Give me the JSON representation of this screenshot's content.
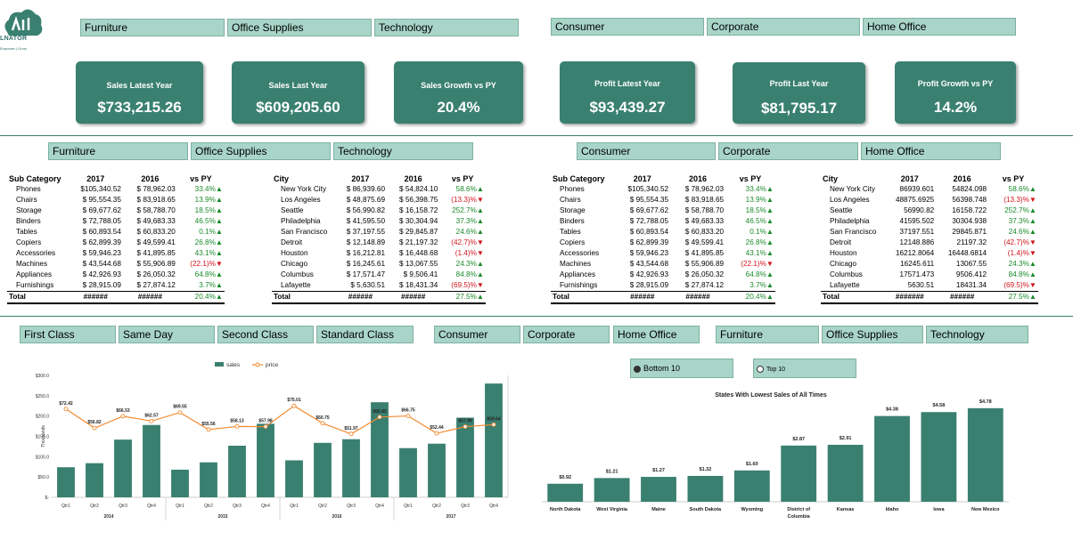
{
  "logo": {
    "text": "LNATOR",
    "tagline": "Empower | Grow",
    "colors": {
      "teal": "#3a8070",
      "light": "#a8d5c8"
    }
  },
  "top_slicers": {
    "category": [
      "Furniture",
      "Office Supplies",
      "Technology"
    ],
    "segment": [
      "Consumer",
      "Corporate",
      "Home Office"
    ]
  },
  "kpis": [
    {
      "title": "Sales Latest Year",
      "value": "$733,215.26"
    },
    {
      "title": "Sales Last Year",
      "value": "$609,205.60"
    },
    {
      "title": "Sales Growth vs PY",
      "value": "20.4%"
    },
    {
      "title": "Profit Latest Year",
      "value": "$93,439.27"
    },
    {
      "title": "Profit Last Year",
      "value": "$81,795.17"
    },
    {
      "title": "Profit Growth vs PY",
      "value": "14.2%"
    }
  ],
  "mid_slicers": {
    "category": [
      "Furniture",
      "Office Supplies",
      "Technology"
    ],
    "segment": [
      "Consumer",
      "Corporate",
      "Home Office"
    ]
  },
  "table1": {
    "headers": [
      "Sub Category",
      "2017",
      "2016",
      "vs PY"
    ],
    "rows": [
      [
        "Phones",
        "$105,340.52",
        "$ 78,962.03",
        "33.4%▲"
      ],
      [
        "Chairs",
        "$ 95,554.35",
        "$ 83,918.65",
        "13.9%▲"
      ],
      [
        "Storage",
        "$ 69,677.62",
        "$ 58,788.70",
        "18.5%▲"
      ],
      [
        "Binders",
        "$ 72,788.05",
        "$ 49,683.33",
        "46.5%▲"
      ],
      [
        "Tables",
        "$ 60,893.54",
        "$ 60,833.20",
        "0.1%▲"
      ],
      [
        "Copiers",
        "$ 62,899.39",
        "$ 49,599.41",
        "26.8%▲"
      ],
      [
        "Accessories",
        "$ 59,946.23",
        "$ 41,895.85",
        "43.1%▲"
      ],
      [
        "Machines",
        "$ 43,544.68",
        "$ 55,906.89",
        "(22.1)%▼"
      ],
      [
        "Appliances",
        "$ 42,926.93",
        "$ 26,050.32",
        "64.8%▲"
      ],
      [
        "Furnishings",
        "$ 28,915.09",
        "$ 27,874.12",
        "3.7%▲"
      ]
    ],
    "total": [
      "Total",
      "######",
      "######",
      "20.4%▲"
    ]
  },
  "table2": {
    "headers": [
      "City",
      "2017",
      "2016",
      "vs PY"
    ],
    "rows": [
      [
        "New York City",
        "$ 86,939.60",
        "$ 54,824.10",
        "58.6%▲"
      ],
      [
        "Los Angeles",
        "$ 48,875.69",
        "$ 56,398.75",
        "(13.3)%▼"
      ],
      [
        "Seattle",
        "$ 56,990.82",
        "$ 16,158.72",
        "252.7%▲"
      ],
      [
        "Philadelphia",
        "$ 41,595.50",
        "$ 30,304.94",
        "37.3%▲"
      ],
      [
        "San Francisco",
        "$ 37,197.55",
        "$ 29,845.87",
        "24.6%▲"
      ],
      [
        "Detroit",
        "$ 12,148.89",
        "$ 21,197.32",
        "(42.7)%▼"
      ],
      [
        "Houston",
        "$ 16,212.81",
        "$ 16,448.68",
        "(1.4)%▼"
      ],
      [
        "Chicago",
        "$ 16,245.61",
        "$ 13,067.55",
        "24.3%▲"
      ],
      [
        "Columbus",
        "$ 17,571.47",
        "$ 9,506.41",
        "84.8%▲"
      ],
      [
        "Lafayette",
        "$ 5,630.51",
        "$ 18,431.34",
        "(69.5)%▼"
      ]
    ],
    "total": [
      "Total",
      "######",
      "######",
      "27.5%▲"
    ]
  },
  "table3": {
    "headers": [
      "Sub Category",
      "2017",
      "2016",
      "vs PY"
    ],
    "rows": [
      [
        "Phones",
        "$105,340.52",
        "$ 78,962.03",
        "33.4%▲"
      ],
      [
        "Chairs",
        "$ 95,554.35",
        "$ 83,918.65",
        "13.9%▲"
      ],
      [
        "Storage",
        "$ 69,677.62",
        "$ 58,788.70",
        "18.5%▲"
      ],
      [
        "Binders",
        "$ 72,788.05",
        "$ 49,683.33",
        "46.5%▲"
      ],
      [
        "Tables",
        "$ 60,893.54",
        "$ 60,833.20",
        "0.1%▲"
      ],
      [
        "Copiers",
        "$ 62,899.39",
        "$ 49,599.41",
        "26.8%▲"
      ],
      [
        "Accessories",
        "$ 59,946.23",
        "$ 41,895.85",
        "43.1%▲"
      ],
      [
        "Machines",
        "$ 43,544.68",
        "$ 55,906.89",
        "(22.1)%▼"
      ],
      [
        "Appliances",
        "$ 42,926.93",
        "$ 26,050.32",
        "64.8%▲"
      ],
      [
        "Furnishings",
        "$ 28,915.09",
        "$ 27,874.12",
        "3.7%▲"
      ]
    ],
    "total": [
      "Total",
      "######",
      "######",
      "20.4%▲"
    ]
  },
  "table4": {
    "headers": [
      "City",
      "2017",
      "2016",
      "vs PY"
    ],
    "rows": [
      [
        "New York City",
        "86939.601",
        "54824.098",
        "58.6%▲"
      ],
      [
        "Los Angeles",
        "48875.6925",
        "56398.748",
        "(13.3)%▼"
      ],
      [
        "Seattle",
        "56990.82",
        "16158.722",
        "252.7%▲"
      ],
      [
        "Philadelphia",
        "41595.502",
        "30304.938",
        "37.3%▲"
      ],
      [
        "San Francisco",
        "37197.551",
        "29845.871",
        "24.6%▲"
      ],
      [
        "Detroit",
        "12148.886",
        "21197.32",
        "(42.7)%▼"
      ],
      [
        "Houston",
        "16212.8064",
        "16448.6814",
        "(1.4)%▼"
      ],
      [
        "Chicago",
        "16245.611",
        "13067.55",
        "24.3%▲"
      ],
      [
        "Columbus",
        "17571.473",
        "9506.412",
        "84.8%▲"
      ],
      [
        "Lafayette",
        "5630.51",
        "18431.34",
        "(69.5)%▼"
      ]
    ],
    "total": [
      "Total",
      "#######",
      "######",
      "27.5%▲"
    ]
  },
  "bottom_slicers": {
    "ship_mode": [
      "First Class",
      "Same Day",
      "Second Class",
      "Standard Class"
    ],
    "segment": [
      "Consumer",
      "Corporate",
      "Home Office"
    ],
    "category": [
      "Furniture",
      "Office Supplies",
      "Technology"
    ]
  },
  "toggle": {
    "bottom": "Bottom 10",
    "top": "Top 10"
  },
  "chart_data": [
    {
      "type": "bar",
      "title": "",
      "ylabel": "Thousands",
      "legend": [
        "sales",
        "price"
      ],
      "legend_position": "top",
      "x_groups": [
        {
          "year": "2014",
          "quarters": [
            "Qtr1",
            "Qtr2",
            "Qtr3",
            "Qtr4"
          ]
        },
        {
          "year": "2015",
          "quarters": [
            "Qtr1",
            "Qtr2",
            "Qtr3",
            "Qtr4"
          ]
        },
        {
          "year": "2016",
          "quarters": [
            "Qtr1",
            "Qtr2",
            "Qtr3",
            "Qtr4"
          ]
        },
        {
          "year": "2017",
          "quarters": [
            "Qtr1",
            "Qtr2",
            "Qtr3",
            "Qtr4"
          ]
        }
      ],
      "yticks": [
        "$-",
        "$50.0",
        "$100.0",
        "$150.0",
        "$200.0",
        "$250.0",
        "$300.0"
      ],
      "ylim": [
        0,
        300
      ],
      "series": [
        {
          "name": "sales",
          "type": "bar",
          "color": "#3a8070",
          "values": [
            74,
            84,
            142,
            178,
            68,
            86,
            127,
            181,
            91,
            134,
            143,
            234,
            121,
            132,
            196,
            280
          ]
        },
        {
          "name": "price",
          "type": "line",
          "color": "#f28a30",
          "values": [
            72.42,
            56.82,
            66.53,
            62.57,
            69.55,
            55.56,
            58.13,
            57.98,
            75.01,
            60.75,
            51.97,
            65.82,
            66.75,
            52.44,
            57.99,
            59.64
          ],
          "labels": [
            "$72.42",
            "$56.82",
            "$66.53",
            "$62.57",
            "$69.55",
            "$55.56",
            "$58.13",
            "$57.98",
            "$75.01",
            "$60.75",
            "$51.97",
            "$65.82",
            "$66.75",
            "$52.44",
            "$57.99",
            "$59.64"
          ]
        }
      ]
    },
    {
      "type": "bar",
      "title": "States With Lowest Sales of All Times",
      "categories": [
        "North Dakota",
        "West Virginia",
        "Maine",
        "South Dakota",
        "Wyoming",
        "District of Columbia",
        "Kansas",
        "Idaho",
        "Iowa",
        "New Mexico"
      ],
      "values": [
        0.92,
        1.21,
        1.27,
        1.32,
        1.6,
        2.87,
        2.91,
        4.38,
        4.58,
        4.78
      ],
      "labels": [
        "$0.92",
        "$1.21",
        "$1.27",
        "$1.32",
        "$1.60",
        "$2.87",
        "$2.91",
        "$4.38",
        "$4.58",
        "$4.78"
      ],
      "color": "#3a8070"
    }
  ]
}
